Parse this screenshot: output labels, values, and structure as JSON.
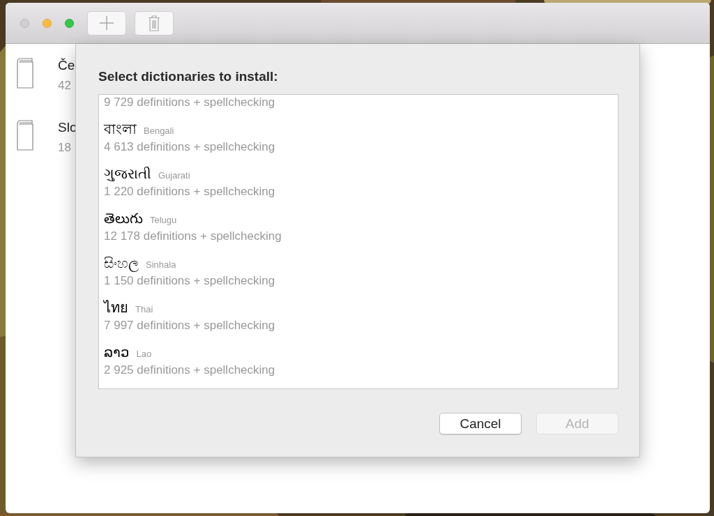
{
  "sidebar": {
    "items": [
      {
        "name": "Če",
        "detail": "42"
      },
      {
        "name": "Slo",
        "detail": "18"
      }
    ]
  },
  "sheet": {
    "title": "Select dictionaries to install:",
    "dictionaries": [
      {
        "detail": "9 729 definitions + spellchecking"
      },
      {
        "native": "বাংলা",
        "english": "Bengali",
        "detail": "4 613 definitions + spellchecking"
      },
      {
        "native": "ગુજરાતી",
        "english": "Gujarati",
        "detail": "1 220 definitions + spellchecking"
      },
      {
        "native": "తెలుగు",
        "english": "Telugu",
        "detail": "12 178 definitions + spellchecking"
      },
      {
        "native": "සිංහල",
        "english": "Sinhala",
        "detail": "1 150 definitions + spellchecking"
      },
      {
        "native": "ไทย",
        "english": "Thai",
        "detail": "7 997 definitions + spellchecking"
      },
      {
        "native": "ລາວ",
        "english": "Lao",
        "detail": "2 925 definitions + spellchecking"
      }
    ],
    "buttons": [
      {
        "label": "Cancel",
        "disabled": false
      },
      {
        "label": "Add",
        "disabled": true
      }
    ]
  }
}
